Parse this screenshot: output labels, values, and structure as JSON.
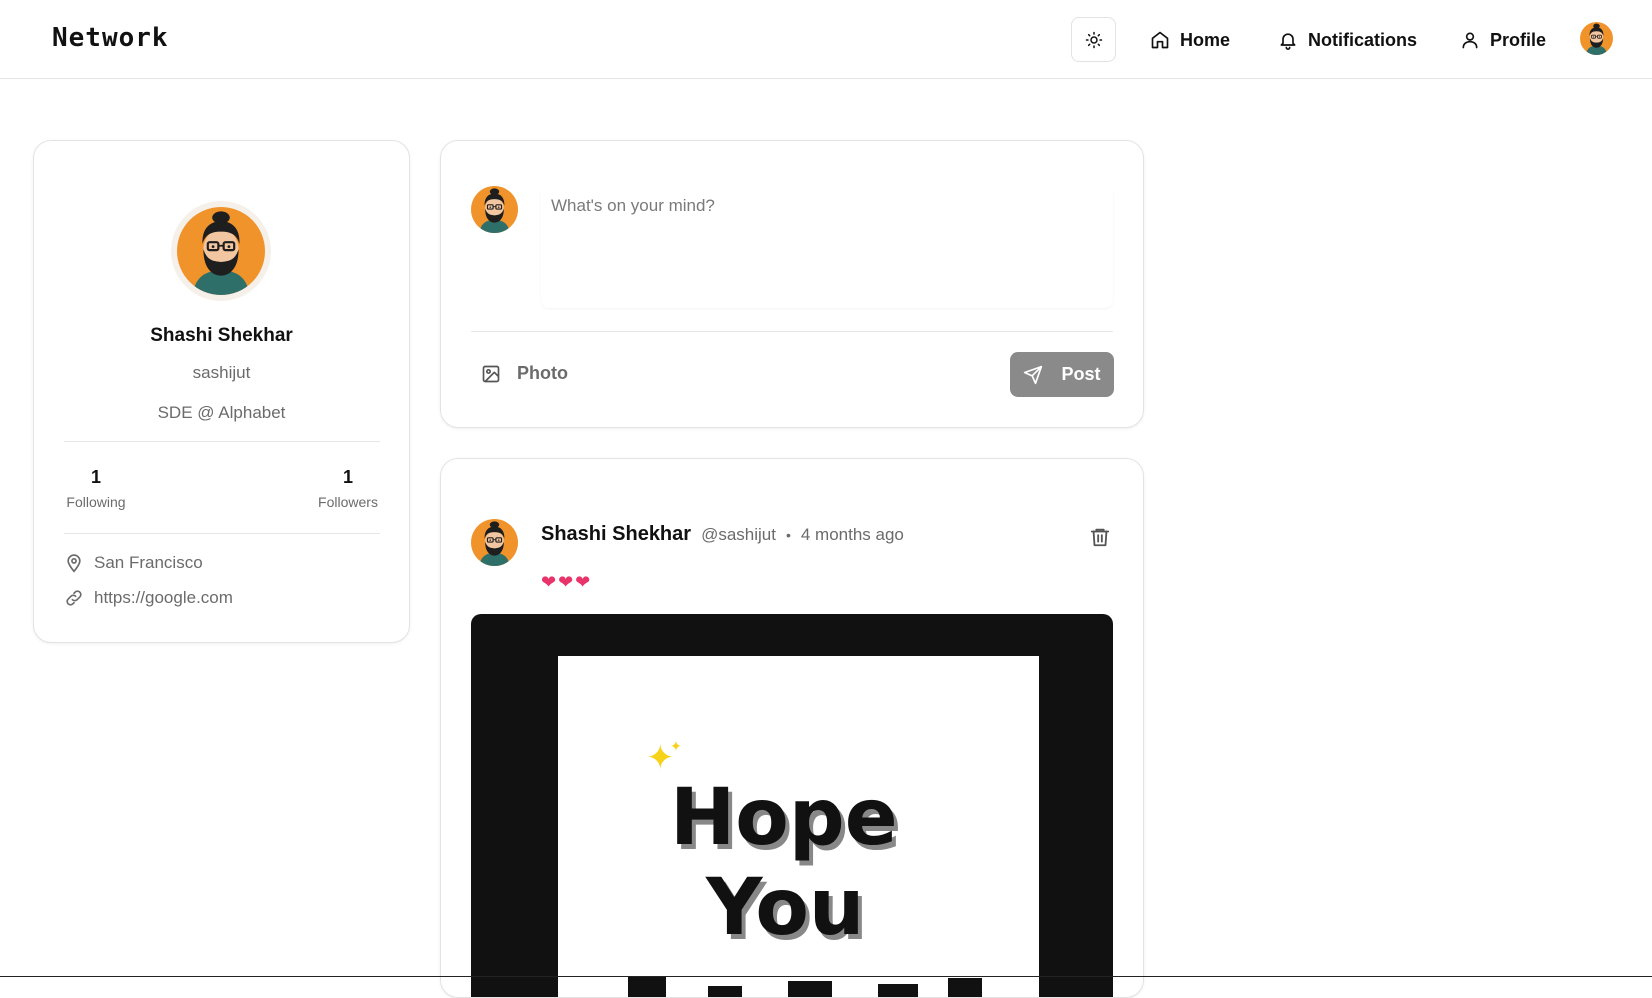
{
  "header": {
    "brand": "Network",
    "nav": {
      "home": "Home",
      "notifications": "Notifications",
      "profile": "Profile"
    }
  },
  "profile": {
    "name": "Shashi Shekhar",
    "username": "sashijut",
    "bio": "SDE @ Alphabet",
    "following_count": "1",
    "following_label": "Following",
    "followers_count": "1",
    "followers_label": "Followers",
    "location": "San Francisco",
    "website": "https://google.com"
  },
  "composer": {
    "placeholder": "What's on your mind?",
    "photo_label": "Photo",
    "post_label": "Post"
  },
  "post": {
    "author": "Shashi Shekhar",
    "handle": "@sashijut",
    "separator": "•",
    "time": "4 months ago",
    "text": "❤❤❤",
    "image_text_line1": "Hope",
    "image_text_line2": "You"
  },
  "colors": {
    "avatar_bg": "#f0932b",
    "post_button": "#8a8a8a",
    "heart": "#e8336b",
    "border": "#e3e3e3"
  },
  "icons": {
    "theme": "sun-icon",
    "home": "home-icon",
    "notifications": "bell-icon",
    "profile": "user-icon",
    "location": "map-pin-icon",
    "link": "link-icon",
    "photo": "image-icon",
    "post": "send-icon",
    "delete": "trash-icon"
  }
}
